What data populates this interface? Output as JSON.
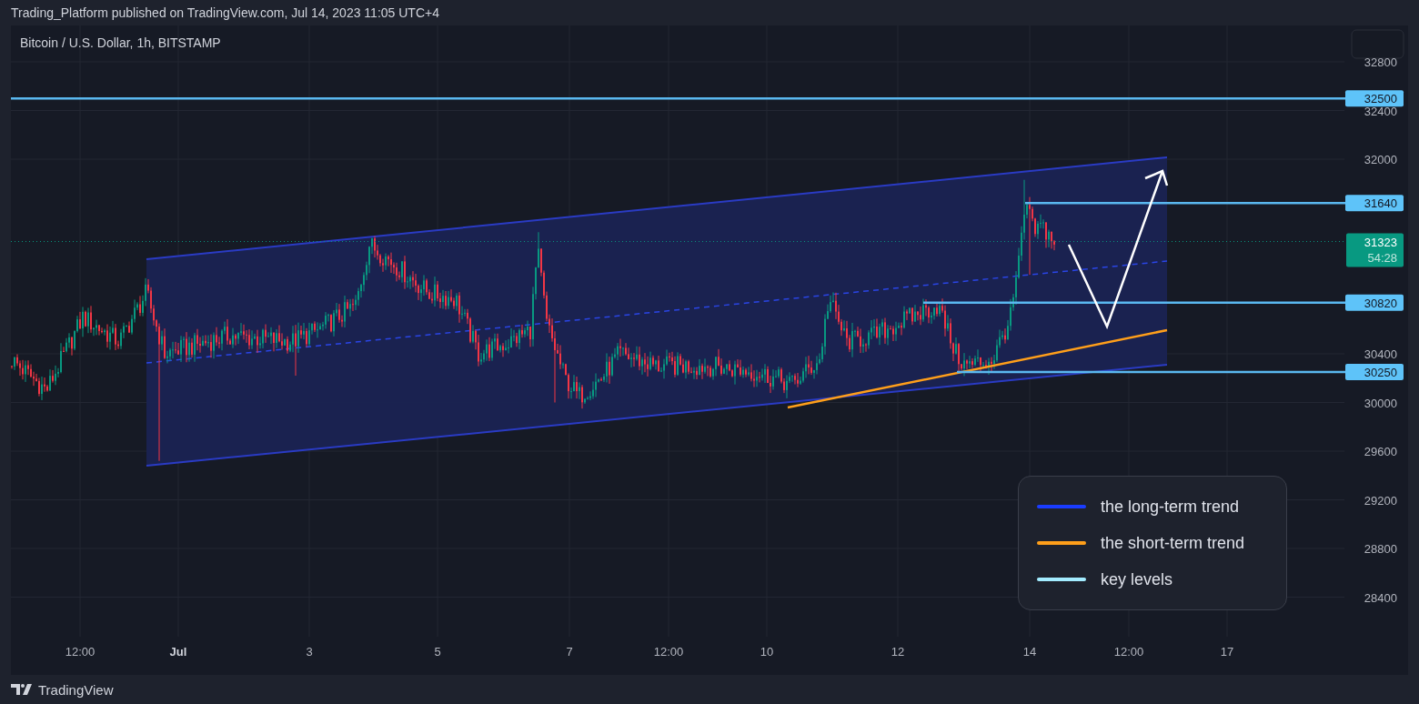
{
  "header": {
    "publisher": "Trading_Platform published on TradingView.com, Jul 14, 2023 11:05 UTC+4"
  },
  "chart": {
    "symbol": "Bitcoin / U.S. Dollar, 1h, BITSTAMP",
    "price_axis": [
      "32800",
      "32400",
      "32000",
      "30400",
      "30000",
      "29600",
      "29200",
      "28800",
      "28400"
    ],
    "time_axis": [
      {
        "label": "12:00",
        "kind": "time"
      },
      {
        "label": "Jul",
        "kind": "month"
      },
      {
        "label": "3",
        "kind": "day"
      },
      {
        "label": "5",
        "kind": "day"
      },
      {
        "label": "7",
        "kind": "day"
      },
      {
        "label": "12:00",
        "kind": "time"
      },
      {
        "label": "10",
        "kind": "day"
      },
      {
        "label": "12",
        "kind": "day"
      },
      {
        "label": "14",
        "kind": "day"
      },
      {
        "label": "12:00",
        "kind": "time"
      },
      {
        "label": "17",
        "kind": "day"
      }
    ],
    "key_levels": [
      "32500",
      "31640",
      "30820",
      "30250"
    ],
    "last_price": {
      "price": "31323",
      "countdown": "54:28"
    },
    "legend": [
      {
        "label": "the long-term trend",
        "color": "#1a3cff"
      },
      {
        "label": "the short-term trend",
        "color": "#ff9f1a"
      },
      {
        "label": "key levels",
        "color": "#a3ecff"
      }
    ]
  },
  "footer": {
    "brand": "TradingView"
  }
}
